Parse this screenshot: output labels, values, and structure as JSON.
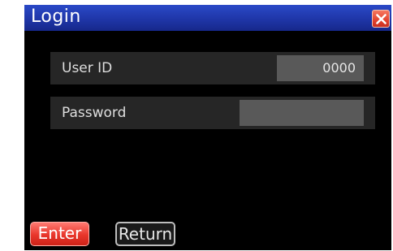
{
  "window": {
    "title": "Login"
  },
  "fields": {
    "user_id": {
      "label": "User ID",
      "value": "0000"
    },
    "password": {
      "label": "Password",
      "value": ""
    }
  },
  "buttons": {
    "enter": "Enter",
    "return": "Return"
  },
  "colors": {
    "titlebar": "#1f36a8",
    "background": "#000000",
    "field_row": "#262626",
    "field_input": "#595959",
    "enter_button": "#e8362b",
    "close_button": "#e3432f"
  },
  "icons": {
    "close": "close-icon"
  }
}
